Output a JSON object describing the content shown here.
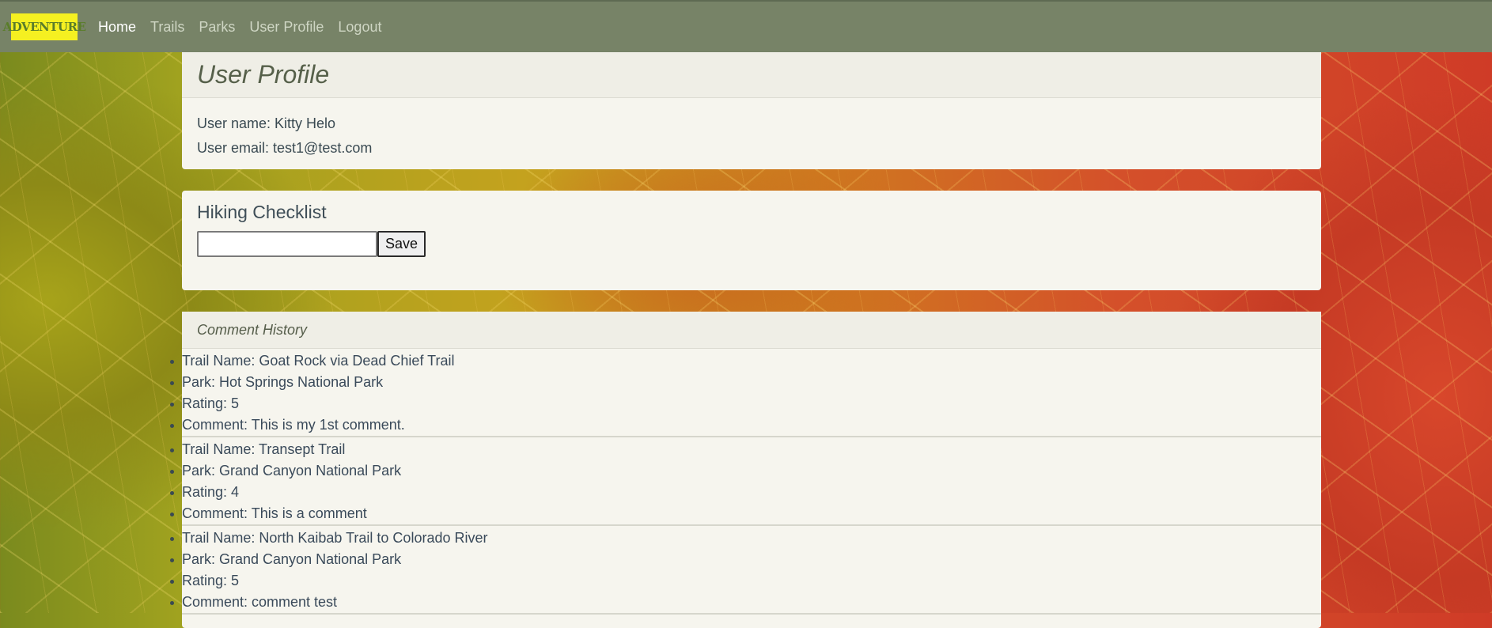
{
  "navbar": {
    "brand": "ADVENTURE",
    "links": [
      "Home",
      "Trails",
      "Parks",
      "User Profile",
      "Logout"
    ]
  },
  "profile": {
    "title": "User Profile",
    "name_line": "User name: Kitty Helo",
    "email_line": "User email: test1@test.com"
  },
  "checklist": {
    "title": "Hiking Checklist",
    "input_value": "",
    "save_label": "Save"
  },
  "comments": {
    "title": "Comment History",
    "entries": [
      {
        "trail": "Trail Name: Goat Rock via Dead Chief Trail",
        "park": "Park: Hot Springs National Park",
        "rating": "Rating: 5",
        "comment": "Comment: This is my 1st comment."
      },
      {
        "trail": "Trail Name: Transept Trail",
        "park": "Park: Grand Canyon National Park",
        "rating": "Rating: 4",
        "comment": "Comment: This is a comment"
      },
      {
        "trail": "Trail Name: North Kaibab Trail to Colorado River",
        "park": "Park: Grand Canyon National Park",
        "rating": "Rating: 5",
        "comment": "Comment: comment test"
      }
    ]
  },
  "colors": {
    "navbar": "#778367",
    "brand_bg": "#f5f021",
    "card_bg": "#f6f5ee"
  }
}
